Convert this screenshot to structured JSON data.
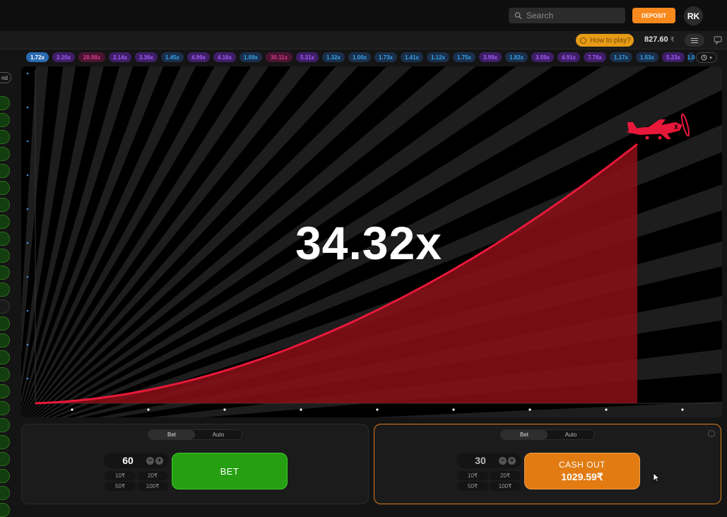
{
  "header": {
    "search_placeholder": "Search",
    "deposit_label": "DEPOSIT",
    "avatar_initials": "RK"
  },
  "subbar": {
    "how_to_play": "How to play?",
    "balance": "827.60",
    "currency": "₹"
  },
  "history": [
    "1.72x",
    "2.20x",
    "28.98x",
    "2.14x",
    "3.36x",
    "1.45x",
    "4.99x",
    "4.16x",
    "1.09x",
    "30.11x",
    "5.31x",
    "1.32x",
    "1.00x",
    "1.73x",
    "1.41x",
    "1.12x",
    "1.75x",
    "3.99x",
    "1.82x",
    "3.59x",
    "4.91x",
    "7.76x",
    "1.17x",
    "1.53x",
    "5.23x",
    "1.0"
  ],
  "history_colors": [
    "first",
    "purple",
    "pink",
    "purple",
    "purple",
    "blue",
    "purple",
    "purple",
    "blue",
    "pink",
    "purple",
    "blue",
    "blue",
    "blue",
    "blue",
    "blue",
    "blue",
    "purple",
    "blue",
    "purple",
    "purple",
    "purple",
    "blue",
    "blue",
    "purple",
    "blue"
  ],
  "sidebar": {
    "tab_label": "nd"
  },
  "game": {
    "multiplier": "34.32x",
    "accent_color": "#e8183a",
    "fill_color": "#8b0f17"
  },
  "bet_panel_left": {
    "tab_bet": "Bet",
    "tab_auto": "Auto",
    "amount": "60",
    "minus": "−",
    "plus": "+",
    "quick": [
      "10₹",
      "20₹",
      "50₹",
      "100₹"
    ],
    "button_label": "BET"
  },
  "bet_panel_right": {
    "tab_bet": "Bet",
    "tab_auto": "Auto",
    "amount": "30",
    "minus": "−",
    "plus": "+",
    "quick": [
      "10₹",
      "20₹",
      "50₹",
      "100₹"
    ],
    "button_line1": "CASH OUT",
    "button_line2": "1029.59₹"
  }
}
